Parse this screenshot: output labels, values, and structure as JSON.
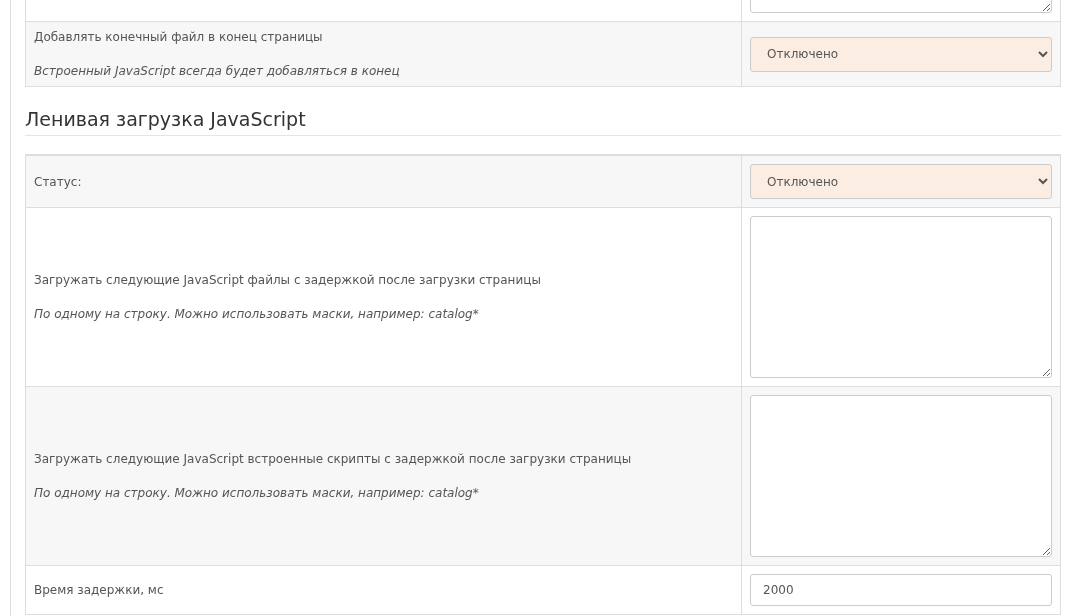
{
  "sections": [
    {
      "rows": [
        {
          "kind": "textarea",
          "value": ""
        },
        {
          "kind": "select",
          "label": "Добавлять конечный файл в конец страницы",
          "help": "Встроенный JavaScript всегда будет добавляться в конец",
          "value": "Отключено"
        }
      ]
    },
    {
      "heading": "Ленивая загрузка JavaScript",
      "rows": [
        {
          "kind": "select",
          "label": "Статус:",
          "value": "Отключено"
        },
        {
          "kind": "textarea",
          "label": "Загружать следующие JavaScript файлы с задержкой после загрузки страницы",
          "help": "По одному на строку. Можно использовать маски, например: catalog*",
          "value": ""
        },
        {
          "kind": "textarea",
          "label": "Загружать следующие JavaScript встроенные скрипты с задержкой после загрузки страницы",
          "help": "По одному на строку. Можно использовать маски, например: catalog*",
          "value": ""
        },
        {
          "kind": "input",
          "label": "Время задержки, мс",
          "value": "2000"
        }
      ]
    }
  ]
}
